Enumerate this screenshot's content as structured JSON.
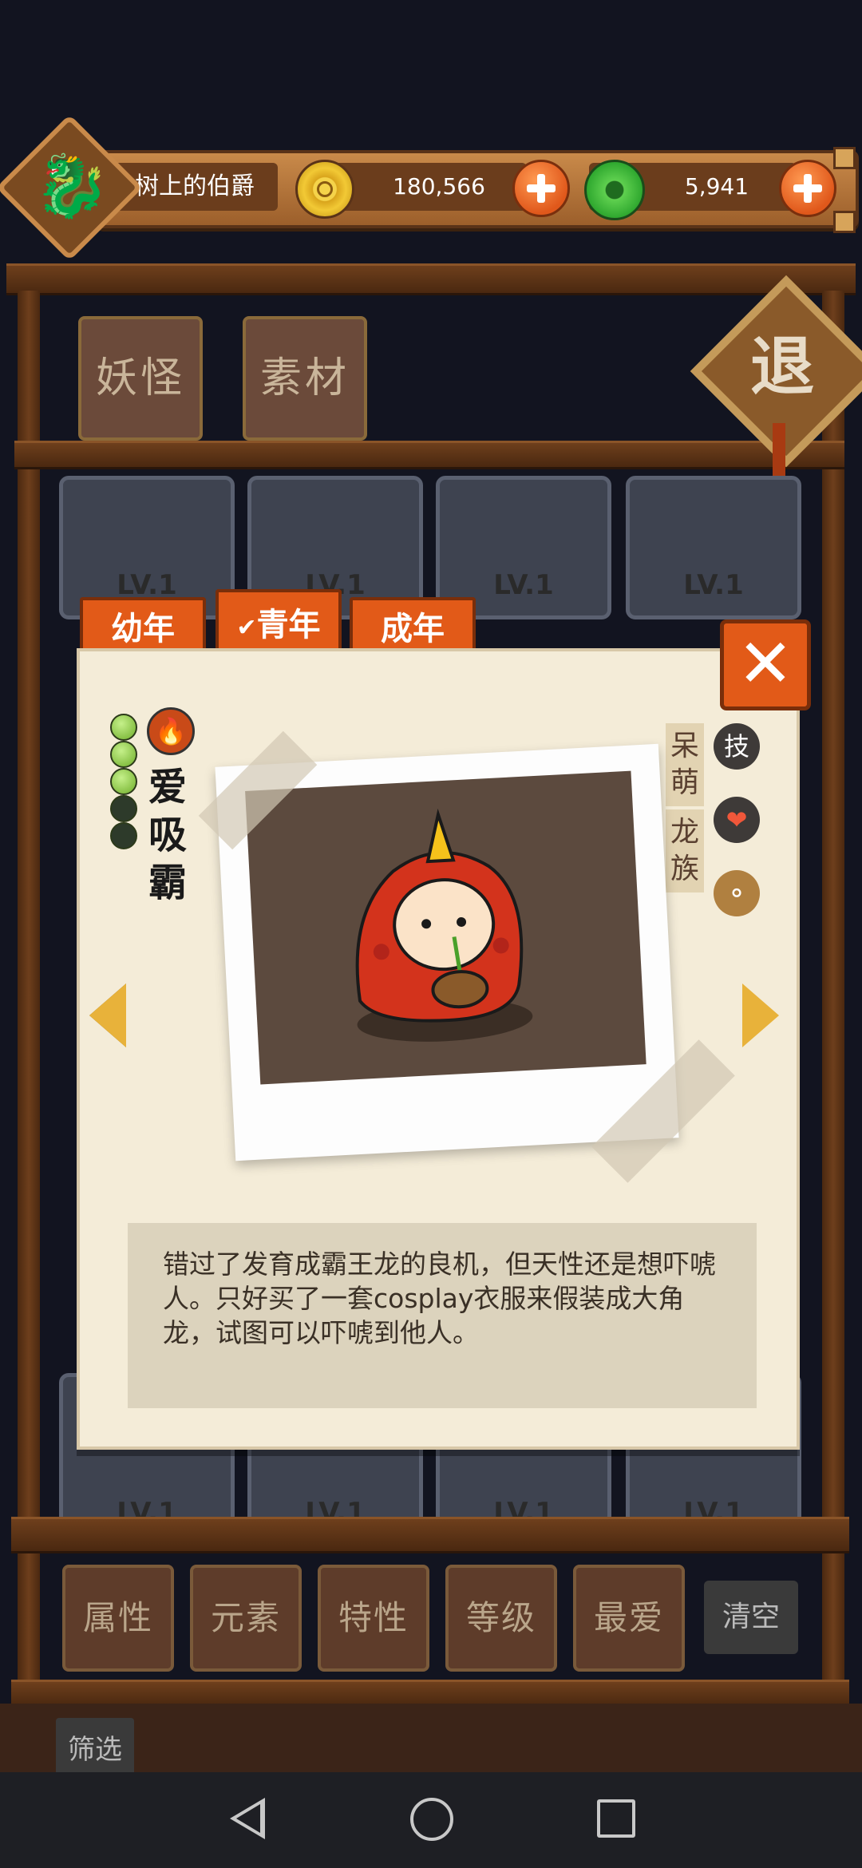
{
  "player": {
    "name": "树上的伯爵",
    "avatar_icon": "🐉"
  },
  "currency": {
    "coins": "180,566",
    "jade": "5,941"
  },
  "top_tabs": [
    "妖怪",
    "素材"
  ],
  "exit_label": "退",
  "grid_level_label": "LV.1",
  "age_tabs": [
    "幼年",
    "青年",
    "成年"
  ],
  "selected_age": "青年",
  "monster": {
    "name_chars": [
      "爱",
      "吸",
      "霸"
    ],
    "element_icon": "fire-icon",
    "stars_filled": 3,
    "stars_total": 5,
    "traits": [
      [
        "呆",
        "萌"
      ],
      [
        "龙",
        "族"
      ]
    ],
    "skill_label": "技",
    "description": "错过了发育成霸王龙的良机，但天性还是想吓唬人。只好买了一套cosplay衣服来假装成大角龙，试图可以吓唬到他人。"
  },
  "filter_buttons": [
    "属性",
    "元素",
    "特性",
    "等级",
    "最爱"
  ],
  "clear_label": "清空",
  "filter_label": "筛选",
  "colors": {
    "accent": "#e25a18",
    "card": "#f4ecd8",
    "wood": "#6e3f1c"
  }
}
